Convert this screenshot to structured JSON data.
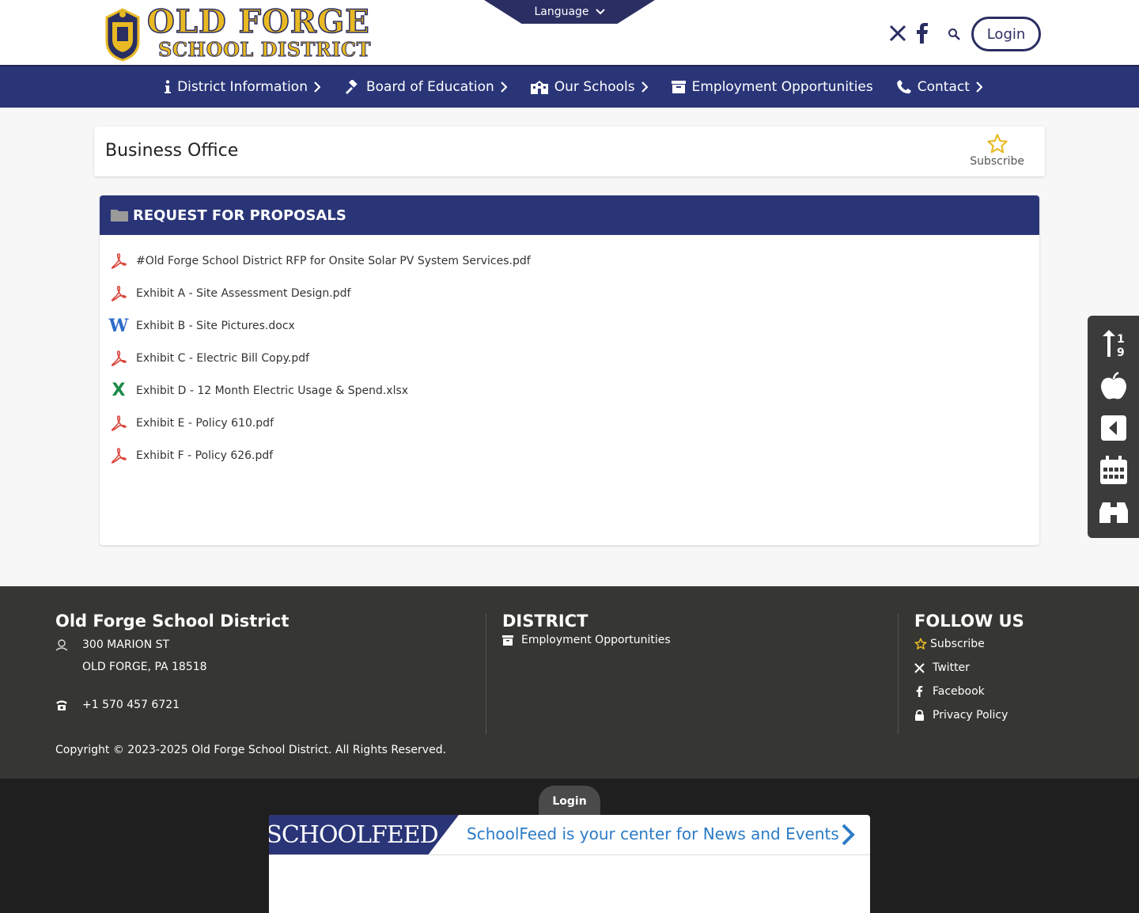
{
  "header": {
    "logo_line1": "OLD FORGE",
    "logo_line2": "SCHOOL DISTRICT",
    "language_label": "Language",
    "login_label": "Login",
    "icons": [
      "x-twitter-icon",
      "facebook-icon",
      "search-icon"
    ]
  },
  "nav": {
    "items": [
      {
        "label": "District Information",
        "icon": "info-icon"
      },
      {
        "label": "Board of Education",
        "icon": "gavel-icon"
      },
      {
        "label": "Our Schools",
        "icon": "school-icon"
      },
      {
        "label": "Employment Opportunities",
        "icon": "archive-icon"
      },
      {
        "label": "Contact",
        "icon": "phone-icon"
      }
    ]
  },
  "page": {
    "title": "Business Office",
    "subscribe_label": "Subscribe"
  },
  "documents": {
    "heading": "REQUEST FOR PROPOSALS",
    "items": [
      {
        "name": "#Old Forge School District RFP for Onsite Solar PV System Services.pdf",
        "type": "pdf"
      },
      {
        "name": "Exhibit A - Site Assessment Design.pdf",
        "type": "pdf"
      },
      {
        "name": "Exhibit B - Site Pictures.docx",
        "type": "word"
      },
      {
        "name": "Exhibit C - Electric Bill Copy.pdf",
        "type": "pdf"
      },
      {
        "name": "Exhibit D - 12 Month Electric Usage & Spend.xlsx",
        "type": "excel"
      },
      {
        "name": "Exhibit E - Policy 610.pdf",
        "type": "pdf"
      },
      {
        "name": "Exhibit F - Policy 626.pdf",
        "type": "pdf"
      }
    ]
  },
  "quick_links": [
    "sort-icon",
    "apple-icon",
    "back-icon",
    "calendar-icon",
    "binoculars-icon"
  ],
  "footer": {
    "district_name": "Old Forge School District",
    "address_line1": "300 MARION ST",
    "address_line2": "OLD FORGE, PA 18518",
    "phone": "+1 570 457 6721",
    "district_heading": "DISTRICT",
    "district_link": "Employment Opportunities",
    "follow_heading": "FOLLOW US",
    "follow_links": [
      "Subscribe",
      "Twitter",
      "Facebook",
      "Privacy Policy"
    ],
    "copyright": "Copyright © 2023-2025 Old Forge School District. All Rights Reserved."
  },
  "bottom": {
    "login_label": "Login",
    "schoolfeed_brand": "SCHOOLFEED",
    "schoolfeed_text": "SchoolFeed is your center for News and Events"
  },
  "colors": {
    "navy": "#2a3578",
    "gold": "#e8b923",
    "footer_bg": "#363632",
    "link_blue": "#2c7bc6"
  }
}
